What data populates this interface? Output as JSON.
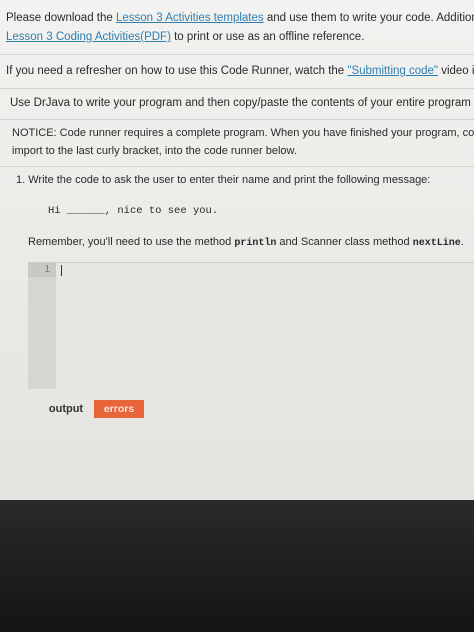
{
  "intro": {
    "p1_a": "Please download the ",
    "p1_link1": "Lesson 3 Activities templates",
    "p1_b": " and use them to write your code. Additionally, y",
    "p1_link2": "Lesson 3 Coding Activities(PDF)",
    "p1_c": " to print or use as an offline reference."
  },
  "refresher": {
    "a": "If you need a refresher on how to use this Code Runner, watch the ",
    "link": "\"Submitting code\"",
    "b": " video in the Co"
  },
  "drjava": "Use DrJava to write your program and then copy/paste the contents of your entire program into the",
  "notice": {
    "line1": "NOTICE: Code runner requires a complete program. When you have finished your program, copy its e",
    "line2": "import to the last curly bracket, into the code runner below."
  },
  "question": {
    "text": "1. Write the code to ask the user to enter their name and print the following message:",
    "sample_hi": "Hi",
    "sample_blank": "______",
    "sample_rest": ", nice to see you.",
    "remember_a": "Remember, you'll need to use the method ",
    "remember_code1": "println",
    "remember_b": " and Scanner class method ",
    "remember_code2": "nextLine",
    "remember_c": "."
  },
  "editor": {
    "line_number": "1"
  },
  "tabs": {
    "output": "output",
    "errors": "errors"
  },
  "colors": {
    "link": "#2f7fb0",
    "errors_tab": "#e8653a"
  }
}
